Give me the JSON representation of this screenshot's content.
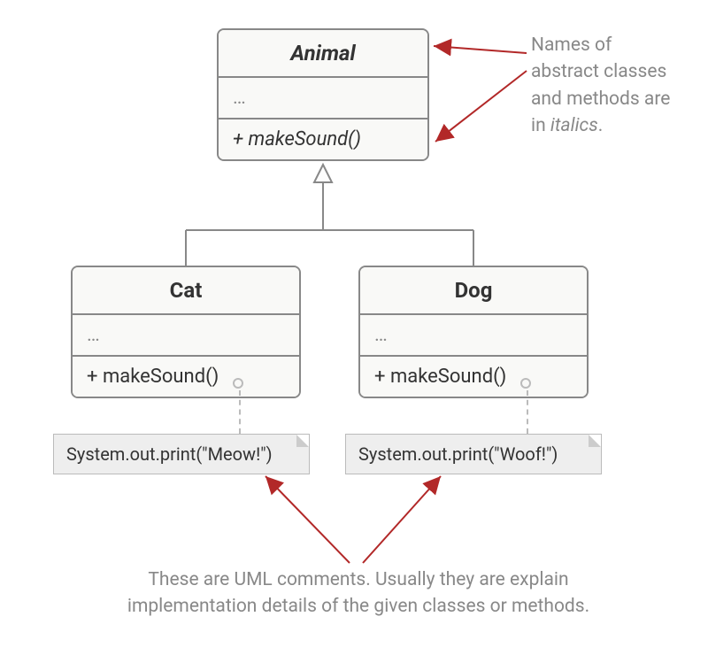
{
  "classes": {
    "animal": {
      "name": "Animal",
      "attrs": "…",
      "method": "+ makeSound()"
    },
    "cat": {
      "name": "Cat",
      "attrs": "…",
      "method": "+ makeSound()"
    },
    "dog": {
      "name": "Dog",
      "attrs": "…",
      "method": "+ makeSound()"
    }
  },
  "notes": {
    "cat_impl": "System.out.print(\"Meow!\")",
    "dog_impl": "System.out.print(\"Woof!\")"
  },
  "captions": {
    "italics_pre": "Names of abstract classes and methods are in ",
    "italics_em": "italics",
    "italics_post": ".",
    "comments": "These are UML comments. Usually they are explain implementation details of the given classes or methods."
  },
  "colors": {
    "arrow": "#b22828",
    "line": "#888888",
    "dotted": "#bbbbbb"
  }
}
